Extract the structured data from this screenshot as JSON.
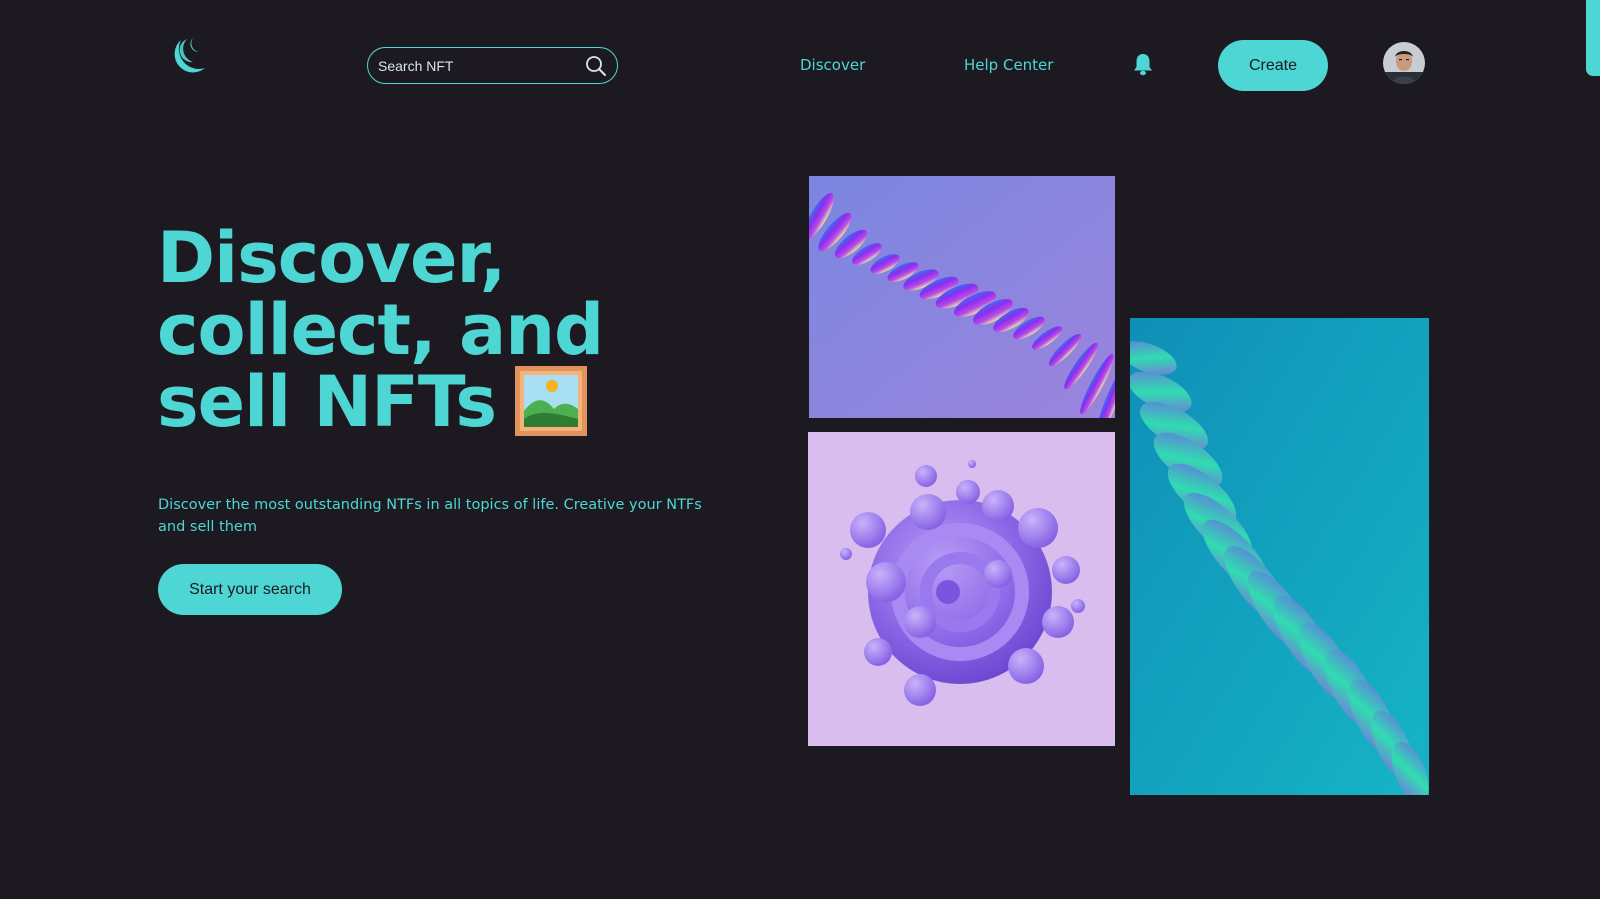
{
  "header": {
    "logo_icon": "crescent-moon-logo",
    "search": {
      "placeholder": "Search NFT",
      "icon": "search-icon"
    },
    "nav": [
      {
        "label": "Discover"
      },
      {
        "label": "Help Center"
      }
    ],
    "notifications_icon": "bell-icon",
    "create_label": "Create",
    "avatar": "user-avatar"
  },
  "hero": {
    "headline_lines": [
      "Discover,",
      "collect, and",
      "sell NFTs"
    ],
    "headline_icon": "framed-picture-icon",
    "subtitle": "Discover the most outstanding NTFs in all topics of life. Creative your NTFs and sell them",
    "cta_label": "Start your search"
  },
  "gallery": [
    {
      "name": "purple-wave-art"
    },
    {
      "name": "purple-sphere-art"
    },
    {
      "name": "teal-ribbon-art"
    }
  ],
  "colors": {
    "background": "#1c1a20",
    "accent": "#4dd6d4"
  }
}
